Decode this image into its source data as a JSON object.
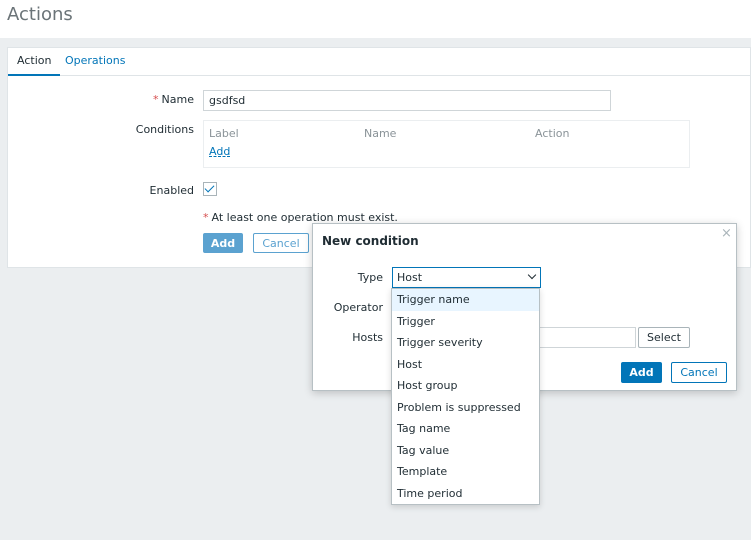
{
  "page": {
    "title": "Actions"
  },
  "tabs": [
    {
      "label": "Action"
    },
    {
      "label": "Operations"
    }
  ],
  "form": {
    "name_label": "Name",
    "name_value": "gsdfsd",
    "conditions_label": "Conditions",
    "conditions_headers": [
      "Label",
      "Name",
      "Action"
    ],
    "conditions_add": "Add",
    "enabled_label": "Enabled",
    "warning": "At least one operation must exist.",
    "add_button": "Add",
    "cancel_button": "Cancel"
  },
  "modal": {
    "title": "New condition",
    "close": "×",
    "type_label": "Type",
    "type_value": "Host",
    "operator_label": "Operator",
    "hosts_label": "Hosts",
    "select_button": "Select",
    "add_button": "Add",
    "cancel_button": "Cancel"
  },
  "dropdown": {
    "options": [
      "Trigger name",
      "Trigger",
      "Trigger severity",
      "Host",
      "Host group",
      "Problem is suppressed",
      "Tag name",
      "Tag value",
      "Template",
      "Time period"
    ],
    "highlighted": "Trigger name"
  },
  "colors": {
    "accent": "#0275b8",
    "required": "#d64e4e",
    "background": "#ebeef0"
  }
}
